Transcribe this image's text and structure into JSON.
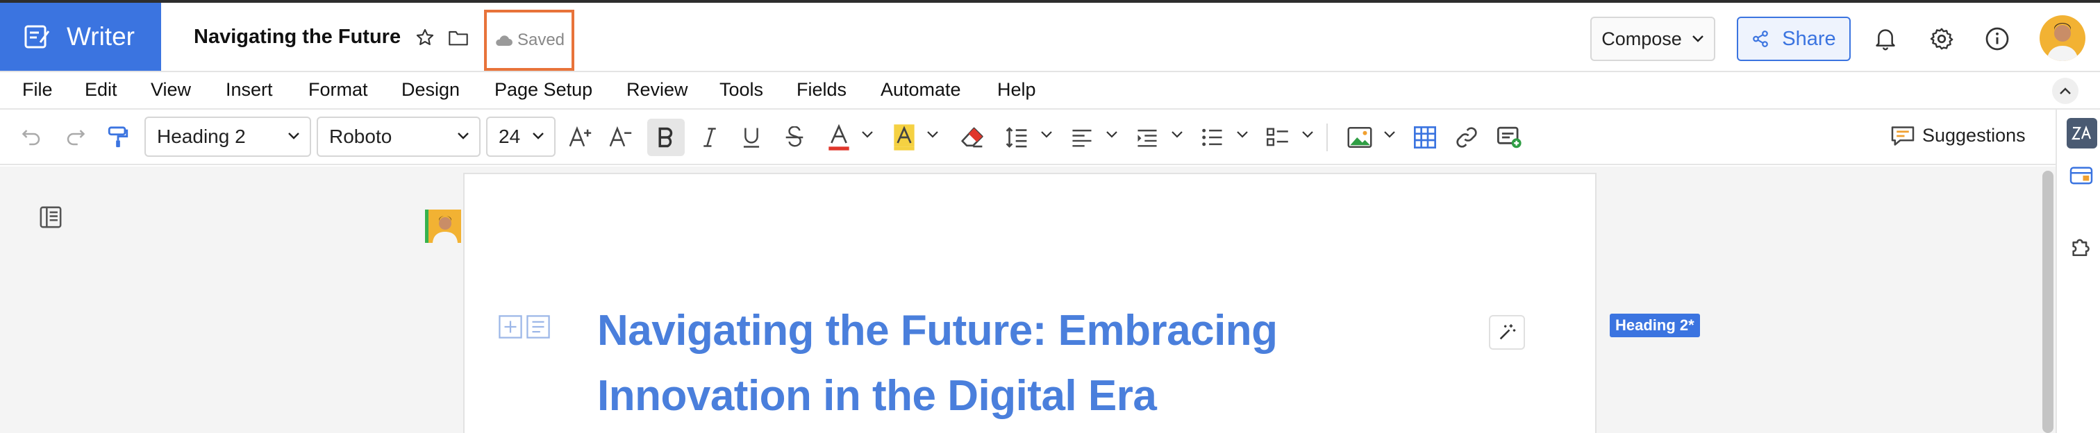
{
  "app": {
    "name": "Writer"
  },
  "document": {
    "title": "Navigating the Future",
    "save_status": "Saved",
    "heading_line1": "Navigating the Future: Embracing",
    "heading_line2": "Innovation in the Digital Era",
    "style_badge": "Heading 2*"
  },
  "header": {
    "compose_label": "Compose",
    "share_label": "Share"
  },
  "menu": [
    "File",
    "Edit",
    "View",
    "Insert",
    "Format",
    "Design",
    "Page Setup",
    "Review",
    "Tools",
    "Fields",
    "Automate",
    "Help"
  ],
  "toolbar": {
    "paragraph_style": "Heading 2",
    "font_family": "Roboto",
    "font_size": "24",
    "suggestions_label": "Suggestions"
  },
  "colors": {
    "brand": "#3b74e0",
    "heading": "#4a7fdc",
    "highlight_outline": "#e8733a",
    "font_color_bar": "#e0362b",
    "highlight_bar": "#f5d142"
  },
  "icons": [
    "writer-logo-icon",
    "star-icon",
    "folder-icon",
    "cloud-icon",
    "share-icon",
    "bell-icon",
    "gear-icon",
    "info-icon",
    "undo-icon",
    "redo-icon",
    "format-painter-icon",
    "bold-icon",
    "italic-icon",
    "underline-icon",
    "strikethrough-icon",
    "font-color-icon",
    "highlight-icon",
    "eraser-icon",
    "line-spacing-icon",
    "align-left-icon",
    "indent-icon",
    "bullet-list-icon",
    "checklist-icon",
    "image-icon",
    "table-icon",
    "link-icon",
    "insert-field-icon",
    "suggestions-icon",
    "zia-icon",
    "panel-icon",
    "puzzle-icon"
  ]
}
